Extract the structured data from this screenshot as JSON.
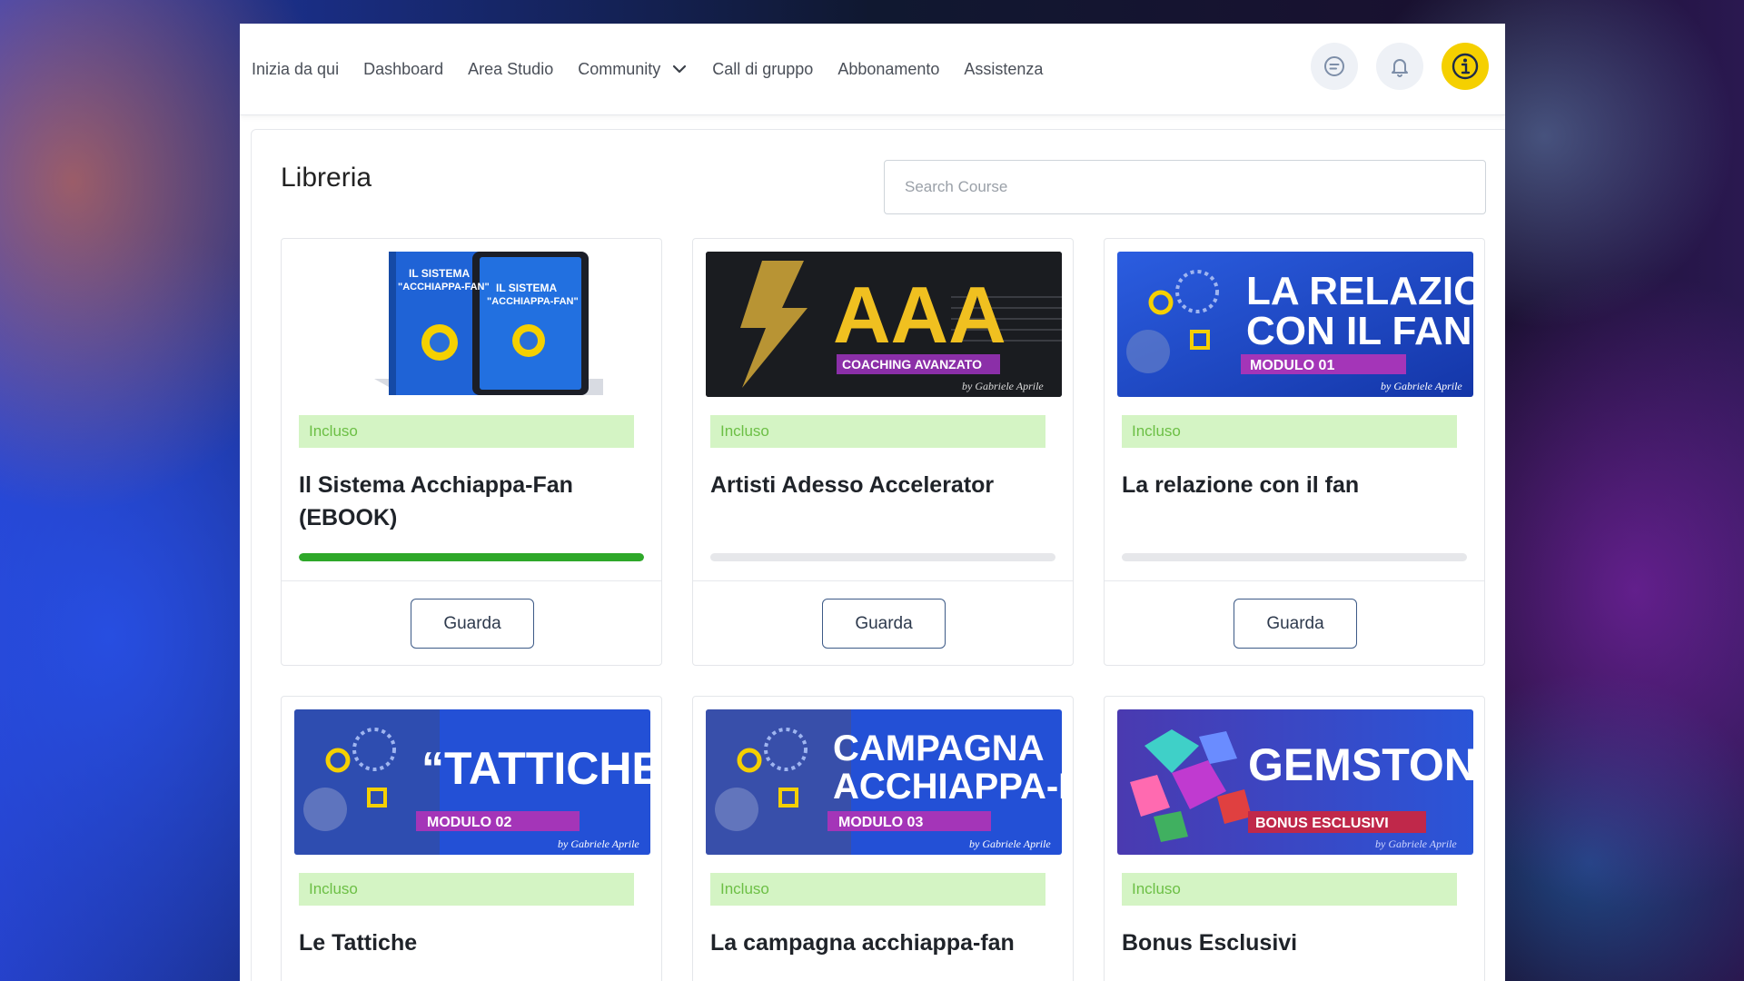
{
  "nav": {
    "items": [
      "Inizia da qui",
      "Dashboard",
      "Area Studio",
      "Community",
      "Call di gruppo",
      "Abbonamento",
      "Assistenza"
    ],
    "icons": [
      "chat-icon",
      "bell-icon",
      "info-icon"
    ],
    "accent": "#f5d000"
  },
  "library": {
    "title": "Libreria",
    "search_placeholder": "Search Course"
  },
  "courses": [
    {
      "title": "Il Sistema Acchiappa-Fan (EBOOK)",
      "badge": "Incluso",
      "button": "Guarda",
      "progress_percent": 100,
      "thumb_text_1": "IL SISTEMA",
      "thumb_text_2": "\"ACCHIAPPA-FAN\""
    },
    {
      "title": "Artisti Adesso Accelerator",
      "badge": "Incluso",
      "button": "Guarda",
      "progress_percent": 0,
      "thumb_text_1": "AAA",
      "thumb_text_2": "COACHING AVANZATO",
      "thumb_text_3": "by Gabriele Aprile"
    },
    {
      "title": "La relazione con il fan",
      "badge": "Incluso",
      "button": "Guarda",
      "progress_percent": 0,
      "thumb_text_1": "LA RELAZIONE",
      "thumb_text_2": "CON IL FAN",
      "thumb_text_3": "MODULO 01",
      "thumb_text_4": "by Gabriele Aprile"
    },
    {
      "title": "Le Tattiche",
      "badge": "Incluso",
      "thumb_text_1": "“TATTICHE”",
      "thumb_text_2": "MODULO 02",
      "thumb_text_3": "by Gabriele Aprile"
    },
    {
      "title": "La campagna acchiappa-fan",
      "badge": "Incluso",
      "thumb_text_1": "CAMPAGNA",
      "thumb_text_2": "ACCHIAPPA-FAN",
      "thumb_text_3": "MODULO 03",
      "thumb_text_4": "by Gabriele Aprile"
    },
    {
      "title": "Bonus Esclusivi",
      "badge": "Incluso",
      "thumb_text_1": "GEMSTONES",
      "thumb_text_2": "BONUS ESCLUSIVI",
      "thumb_text_3": "by Gabriele Aprile"
    }
  ]
}
